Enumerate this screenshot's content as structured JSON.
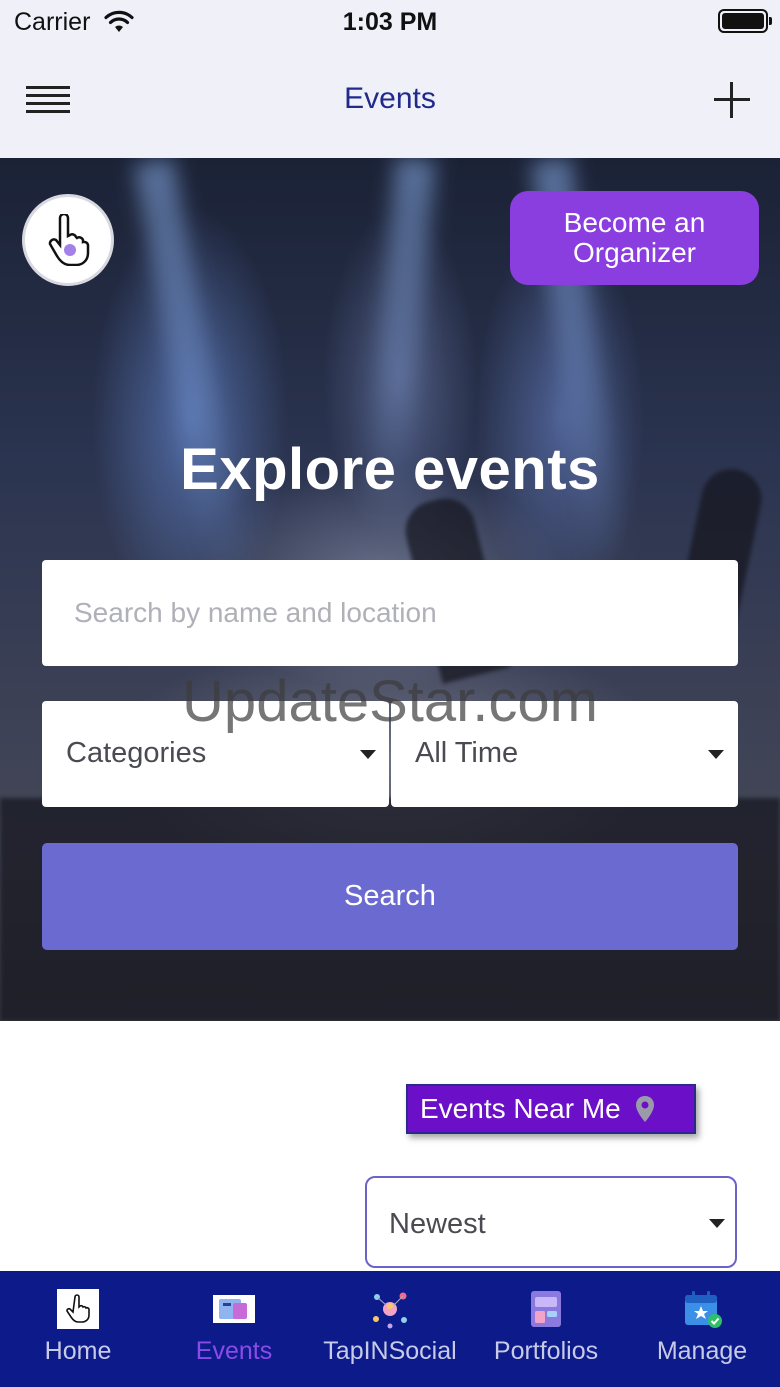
{
  "status_bar": {
    "carrier": "Carrier",
    "time": "1:03 PM"
  },
  "header": {
    "title": "Events",
    "menu_icon": "hamburger-icon",
    "add_icon": "plus-icon"
  },
  "hero": {
    "organizer_button": "Become an Organizer",
    "title": "Explore events",
    "search_placeholder": "Search by name and location",
    "categories_select": "Categories",
    "time_select": "All Time",
    "search_button": "Search",
    "watermark": "UpdateStar.com"
  },
  "content": {
    "near_me_button": "Events Near Me",
    "sort_select": "Newest"
  },
  "tabbar": {
    "tabs": [
      {
        "label": "Home",
        "icon": "home-cursor-icon"
      },
      {
        "label": "Events",
        "icon": "events-icon"
      },
      {
        "label": "TapINSocial",
        "icon": "social-icon"
      },
      {
        "label": "Portfolios",
        "icon": "portfolio-icon"
      },
      {
        "label": "Manage",
        "icon": "calendar-check-icon"
      }
    ],
    "active_tab": "Events"
  },
  "colors": {
    "header_bg": "#eff0f8",
    "header_title": "#1f2a8c",
    "organizer_button": "#8a3ee0",
    "search_button": "#6a6ad0",
    "near_me_button": "#6b10c8",
    "tabbar_bg": "#0d1a8a",
    "tab_active": "#8a4be8"
  }
}
